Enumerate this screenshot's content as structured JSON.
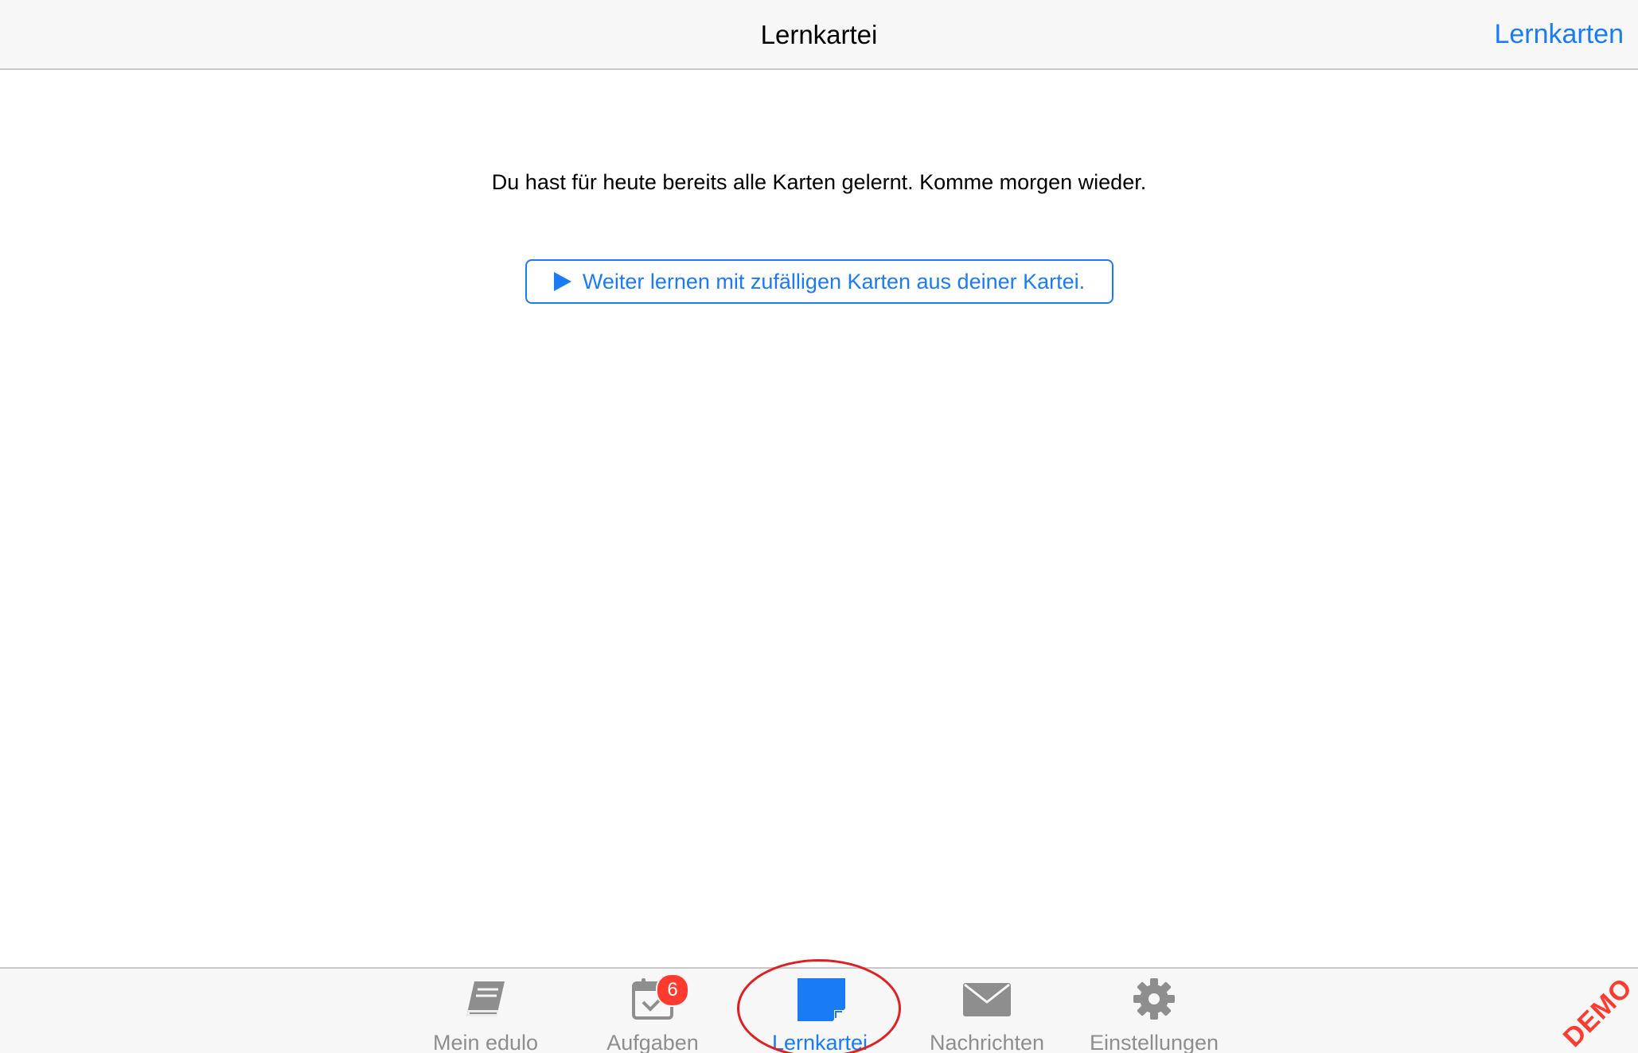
{
  "navbar": {
    "title": "Lernkartei",
    "right_button": "Lernkarten"
  },
  "content": {
    "message": "Du hast für heute bereits alle Karten gelernt. Komme morgen wieder.",
    "continue_button": "Weiter lernen mit zufälligen Karten aus deiner Kartei."
  },
  "tabbar": {
    "tabs": [
      {
        "label": "Mein edulo",
        "icon": "book-icon"
      },
      {
        "label": "Aufgaben",
        "icon": "calendar-check-icon",
        "badge": "6"
      },
      {
        "label": "Lernkartei",
        "icon": "flashcard-icon",
        "active": true
      },
      {
        "label": "Nachrichten",
        "icon": "envelope-icon"
      },
      {
        "label": "Einstellungen",
        "icon": "gear-icon"
      }
    ]
  },
  "demo_label": "DEMO",
  "colors": {
    "accent": "#1a7cf5",
    "inactive": "#8e8e8e",
    "badge": "#ff3b30",
    "annotation": "#e02020"
  }
}
